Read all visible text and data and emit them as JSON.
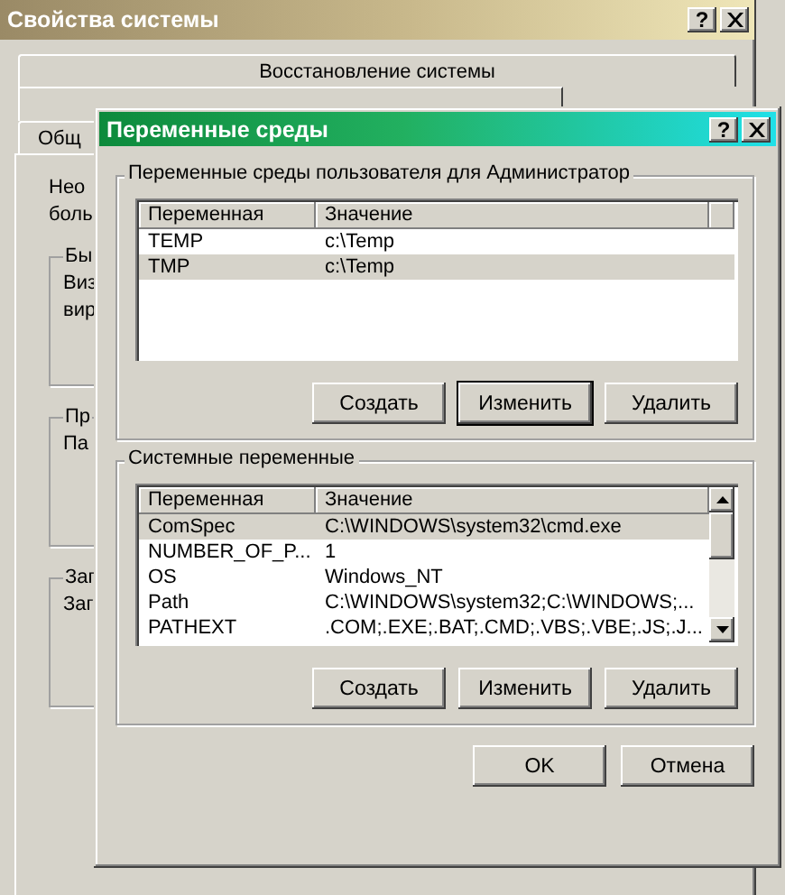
{
  "background_window": {
    "title": "Свойства системы",
    "help_button": "?",
    "tab_rows": [
      [
        {
          "label": "Восстановление системы",
          "selected": false
        }
      ],
      [
        {
          "label": "Общ",
          "selected": true
        }
      ]
    ],
    "page": {
      "intro": [
        "Нео",
        "боль"
      ],
      "groups": [
        {
          "title": "Бы",
          "lines": [
            "Виз",
            "вир"
          ]
        },
        {
          "title": "Пр",
          "lines": [
            "Па"
          ]
        },
        {
          "title": "Заг",
          "lines": [
            "Заг"
          ]
        }
      ]
    }
  },
  "dialog": {
    "title": "Переменные среды",
    "help_button": "?",
    "groups": [
      {
        "title": "Переменные среды пользователя для Администратор",
        "columns": [
          "Переменная",
          "Значение"
        ],
        "scrollbar": false,
        "rows": [
          {
            "name": "TEMP",
            "value": "c:\\Temp",
            "selected": false
          },
          {
            "name": "TMP",
            "value": "c:\\Temp",
            "selected": true
          }
        ],
        "buttons": [
          {
            "label": "Создать",
            "default": false
          },
          {
            "label": "Изменить",
            "default": true
          },
          {
            "label": "Удалить",
            "default": false
          }
        ]
      },
      {
        "title": "Системные переменные",
        "columns": [
          "Переменная",
          "Значение"
        ],
        "scrollbar": true,
        "rows": [
          {
            "name": "ComSpec",
            "value": "C:\\WINDOWS\\system32\\cmd.exe",
            "selected": true
          },
          {
            "name": "NUMBER_OF_P...",
            "value": "1",
            "selected": false
          },
          {
            "name": "OS",
            "value": "Windows_NT",
            "selected": false
          },
          {
            "name": "Path",
            "value": "C:\\WINDOWS\\system32;C:\\WINDOWS;...",
            "selected": false
          },
          {
            "name": "PATHEXT",
            "value": ".COM;.EXE;.BAT;.CMD;.VBS;.VBE;.JS;.J...",
            "selected": false
          }
        ],
        "buttons": [
          {
            "label": "Создать",
            "default": false
          },
          {
            "label": "Изменить",
            "default": false
          },
          {
            "label": "Удалить",
            "default": false
          }
        ]
      }
    ],
    "footer_buttons": [
      {
        "label": "OK",
        "default": false
      },
      {
        "label": "Отмена",
        "default": false
      }
    ]
  }
}
